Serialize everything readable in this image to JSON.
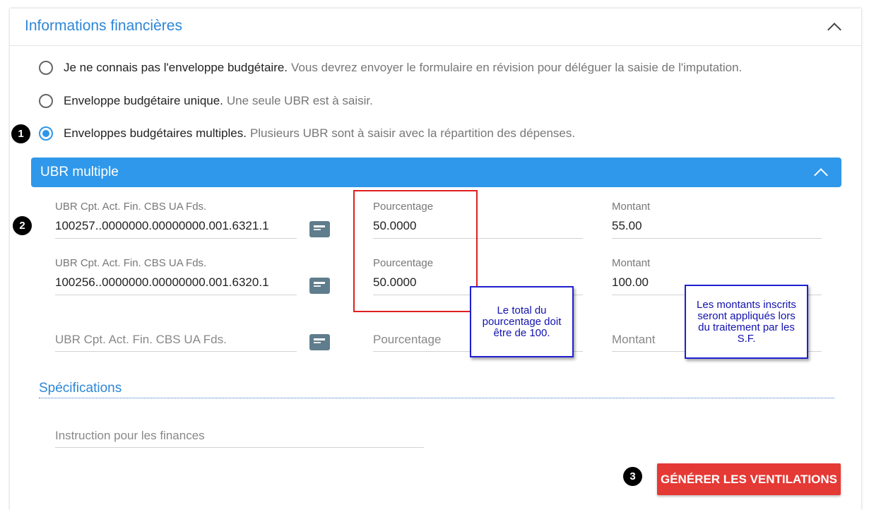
{
  "panel": {
    "title": "Informations financières"
  },
  "radios": [
    {
      "label": "Je ne connais pas l'enveloppe budgétaire.",
      "desc": "Vous devrez envoyer le formulaire en révision pour déléguer la saisie de l'imputation.",
      "checked": false
    },
    {
      "label": "Enveloppe budgétaire unique.",
      "desc": "Une seule UBR est à saisir.",
      "checked": false
    },
    {
      "label": "Enveloppes budgétaires multiples.",
      "desc": "Plusieurs UBR sont à saisir avec la répartition des dépenses.",
      "checked": true
    }
  ],
  "badges": {
    "b1": "1",
    "b2": "2",
    "b3": "3"
  },
  "ubr_section": {
    "title": "UBR multiple"
  },
  "rows": [
    {
      "ubr_label": "UBR Cpt. Act. Fin. CBS UA Fds.",
      "ubr_value": "100257..0000000.00000000.001.6321.1",
      "pct_label": "Pourcentage",
      "pct_value": "50.0000",
      "amt_label": "Montant",
      "amt_value": "55.00"
    },
    {
      "ubr_label": "UBR Cpt. Act. Fin. CBS UA Fds.",
      "ubr_value": "100256..0000000.00000000.001.6320.1",
      "pct_label": "Pourcentage",
      "pct_value": "50.0000",
      "amt_label": "Montant",
      "amt_value": "100.00"
    }
  ],
  "empty_row": {
    "ubr_placeholder": "UBR Cpt. Act. Fin. CBS UA Fds.",
    "pct_placeholder": "Pourcentage",
    "amt_placeholder": "Montant"
  },
  "annotations": {
    "pct_note": "Le total du pourcentage doit être de 100.",
    "amt_note": "Les montants inscrits seront appliqués lors du traitement par les S.F."
  },
  "specs": {
    "title": "Spécifications",
    "instruction_placeholder": "Instruction pour les finances"
  },
  "actions": {
    "generate_label": "GÉNÉRER LES VENTILATIONS"
  },
  "colors": {
    "accent": "#2f98ea",
    "title_blue": "#2e86d6",
    "danger": "#e53935",
    "note_blue": "#2020d0",
    "highlight_red": "#e02020"
  }
}
